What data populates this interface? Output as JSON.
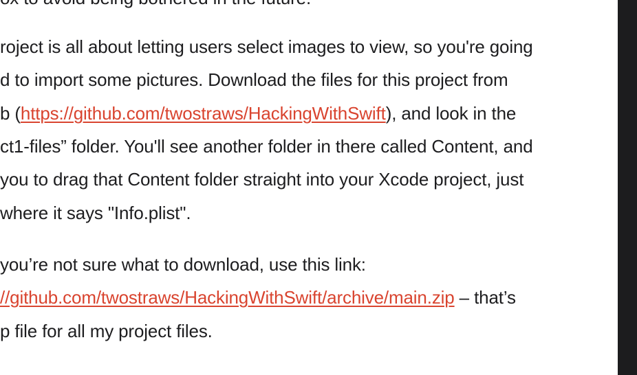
{
  "article": {
    "top_line": "ox to avoid being bothered in the future.",
    "paragraph1": {
      "line1": "roject is all about letting users select images to view, so you're going",
      "line2": "d to import some pictures. Download the files for this project from",
      "line3_before": "b (",
      "line3_link": "https://github.com/twostraws/HackingWithSwift",
      "line3_after": "), and look in the",
      "line4": "ct1-files” folder. You'll see another folder in there called Content, and",
      "line5": " you to drag that Content folder straight into your Xcode project, just",
      "line6": " where it says \"Info.plist\"."
    },
    "paragraph2": {
      "line1": " you’re not sure what to download, use this link:",
      "line2_link": "//github.com/twostraws/HackingWithSwift/archive/main.zip",
      "line2_after": " – that’s",
      "line3": "p file for all my project files."
    }
  },
  "colors": {
    "text": "#1d1d1f",
    "link": "#d9442f",
    "background": "#ffffff",
    "sidebar": "#1c1c1e"
  }
}
